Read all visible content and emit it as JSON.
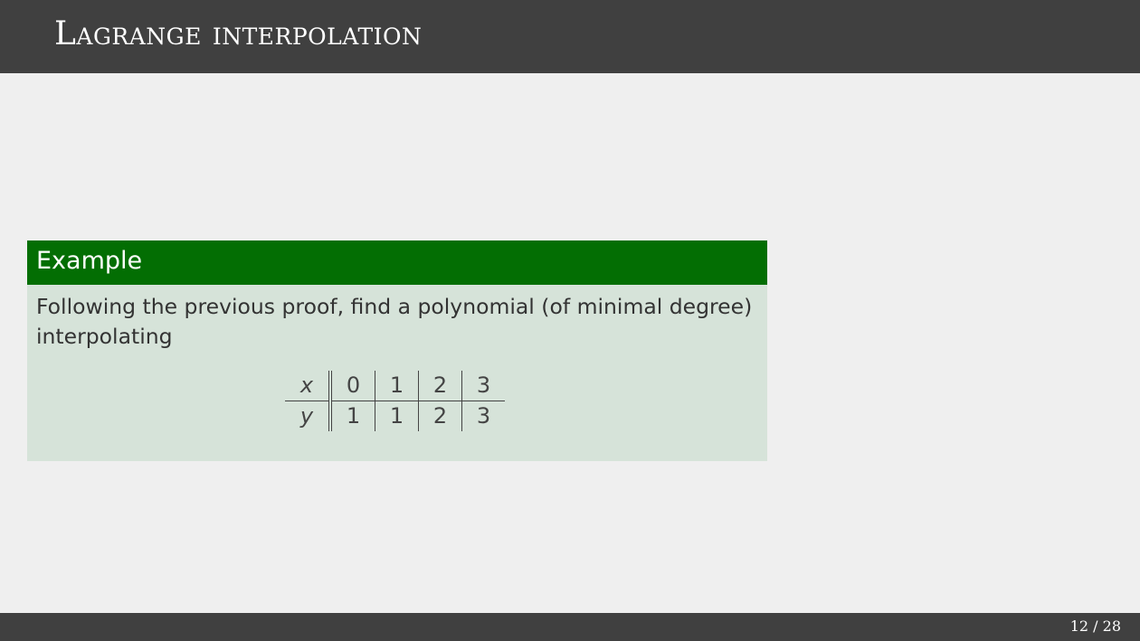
{
  "slide": {
    "title": "Lagrange interpolation"
  },
  "block": {
    "title": "Example",
    "text_line1": "Following the previous proof, find a polynomial (of minimal degree)",
    "text_line2": "interpolating"
  },
  "table": {
    "rows": [
      {
        "label": "x",
        "values": [
          "0",
          "1",
          "2",
          "3"
        ]
      },
      {
        "label": "y",
        "values": [
          "1",
          "1",
          "2",
          "3"
        ]
      }
    ]
  },
  "footer": {
    "page": "12 / 28"
  }
}
